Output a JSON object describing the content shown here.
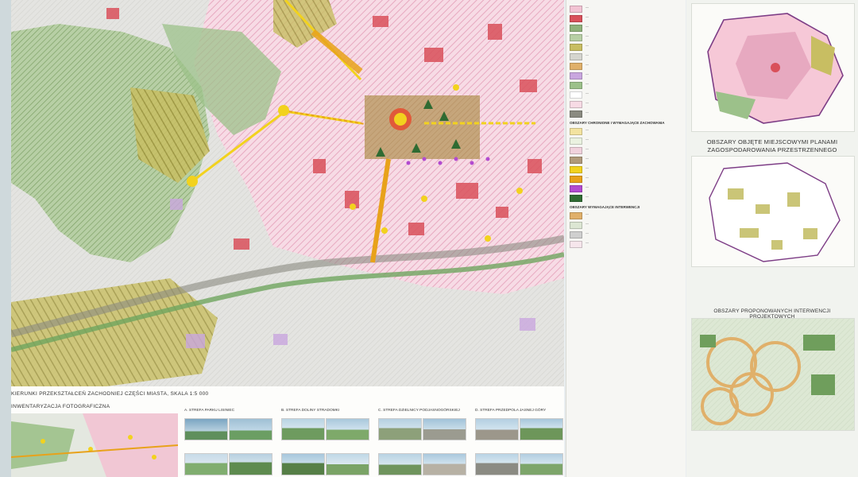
{
  "main_map": {
    "title": "KIERUNKI PRZEKSZTAŁCEŃ ZACHODNIEJ CZĘŚCI MIASTA, SKALA 1:5 000"
  },
  "photo_inventory": {
    "title": "INWENTARYZACJA FOTOGRAFICZNA",
    "zones": [
      {
        "title": "A. STREFA PARKU LISINIEC"
      },
      {
        "title": "B. STREFA DOLINY STRADOMKI"
      },
      {
        "title": "C. STREFA DZIELNICY PODJASNOGÓRSKIEJ"
      },
      {
        "title": "D. STREFA PRZEDPOLA JASNEJ GÓRY"
      }
    ]
  },
  "legend": {
    "section_a": "OBSZARY CHRONIONE I WYMAGAJĄCE ZACHOWANIA",
    "section_b": "OBSZARY WYMAGAJĄCE INTERWENCJI"
  },
  "right_col": {
    "plans_title_1": "OBSZARY OBJĘTE MIEJSCOWYMI PLANAMI",
    "plans_title_2": "ZAGOSPODAROWANIA PRZESTRZENNEGO",
    "interventions_title": "OBSZARY PROPONOWANYCH INTERWENCJI PROJEKTOWYCH"
  },
  "colors": {
    "green": "#8fb17a",
    "pink": "#f2c3d3",
    "red": "#d9505a",
    "yellow": "#f2d21e",
    "olive": "#b9b24a",
    "gray": "#b7b7b0"
  }
}
